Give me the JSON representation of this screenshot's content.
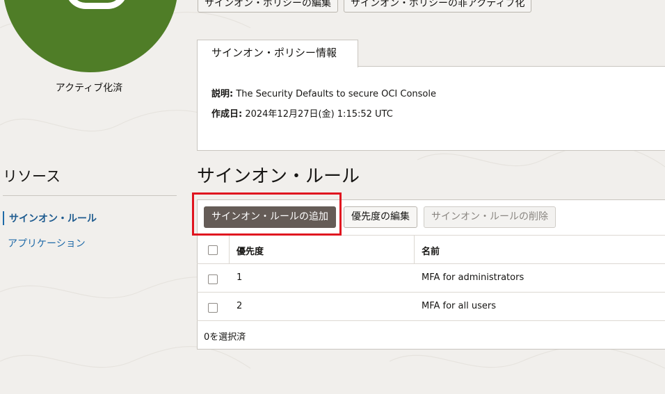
{
  "status": {
    "label": "アクティブ化済",
    "color": "#4f7d27"
  },
  "top_buttons": {
    "edit_policy": "サインオン・ポリシーの編集",
    "deactivate_policy": "サインオン・ポリシーの非アクティブ化"
  },
  "info": {
    "tab": "サインオン・ポリシー情報",
    "description_label": "説明:",
    "description_value": "The Security Defaults to secure OCI Console",
    "created_label": "作成日:",
    "created_value": "2024年12月27日(金) 1:15:52 UTC"
  },
  "resources": {
    "title": "リソース",
    "items": [
      {
        "label": "サインオン・ルール",
        "active": true
      },
      {
        "label": "アプリケーション",
        "active": false
      }
    ]
  },
  "rules": {
    "title": "サインオン・ルール",
    "buttons": {
      "add": "サインオン・ルールの追加",
      "edit_priority": "優先度の編集",
      "delete": "サインオン・ルールの削除"
    },
    "columns": [
      "優先度",
      "名前"
    ],
    "rows": [
      {
        "priority": "1",
        "name": "MFA for administrators"
      },
      {
        "priority": "2",
        "name": "MFA for all users"
      }
    ],
    "selected_text": "0を選択済"
  },
  "colors": {
    "accent": "#1f6aa8",
    "primary_button": "#655c57",
    "highlight": "#e0141f"
  }
}
